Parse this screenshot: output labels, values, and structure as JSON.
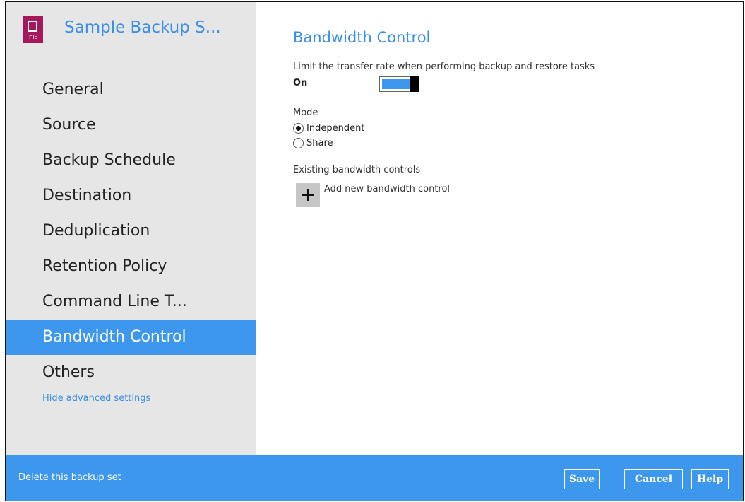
{
  "backup_set": {
    "title": "Sample Backup S...",
    "icon": "file-icon",
    "icon_tag": "File",
    "icon_color": "#a3195b"
  },
  "sidebar": {
    "items": [
      {
        "label": "General"
      },
      {
        "label": "Source"
      },
      {
        "label": "Backup Schedule"
      },
      {
        "label": "Destination"
      },
      {
        "label": "Deduplication"
      },
      {
        "label": "Retention Policy"
      },
      {
        "label": "Command Line T..."
      },
      {
        "label": "Bandwidth Control",
        "active": true
      },
      {
        "label": "Others"
      }
    ],
    "hide_advanced": "Hide advanced settings"
  },
  "main": {
    "title": "Bandwidth Control",
    "description": "Limit the transfer rate when performing backup and restore tasks",
    "toggle_label": "On",
    "toggle_on": true,
    "mode_label": "Mode",
    "modes": [
      {
        "label": "Independent",
        "selected": true
      },
      {
        "label": "Share",
        "selected": false
      }
    ],
    "existing_label": "Existing bandwidth controls",
    "add_icon": "+",
    "add_label": "Add new bandwidth control"
  },
  "footer": {
    "delete_label": "Delete this backup set",
    "save_label": "Save",
    "cancel_label": "Cancel",
    "help_label": "Help"
  },
  "colors": {
    "accent": "#3d97ec",
    "title_blue": "#3b8fe6",
    "sidebar_bg": "#e6e6e6"
  }
}
